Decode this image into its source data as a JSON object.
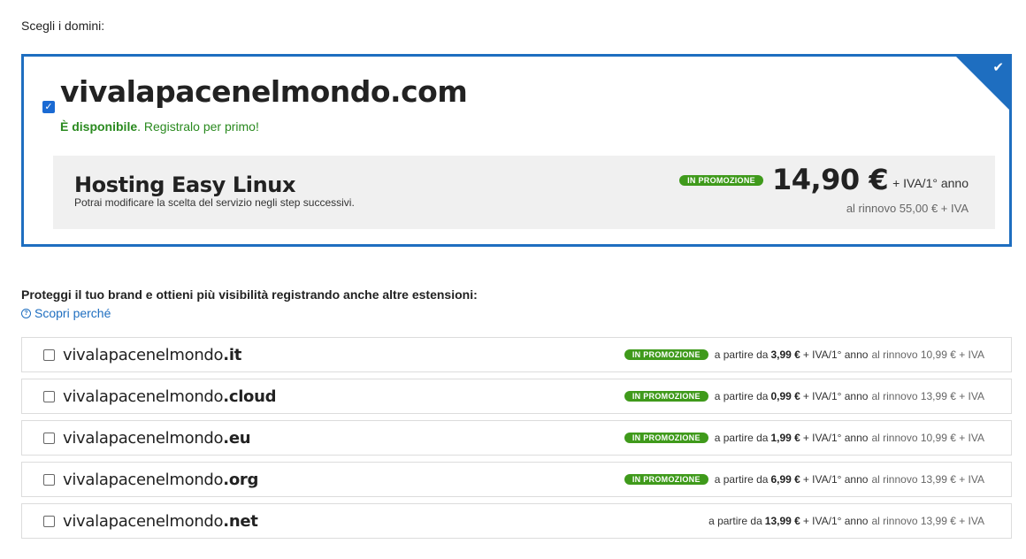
{
  "heading": "Scegli i domini:",
  "main": {
    "domain": "vivalapacenelmondo.com",
    "available_strong": "È disponibile",
    "available_rest": ". Registralo per primo!",
    "hosting_title": "Hosting Easy Linux",
    "hosting_sub": "Potrai modificare la scelta del servizio negli step successivi.",
    "promo": "IN PROMOZIONE",
    "price": "14,90 €",
    "price_suffix": "+ IVA/1° anno",
    "renewal": "al rinnovo 55,00 € + IVA",
    "checked": true
  },
  "section": {
    "title": "Proteggi il tuo brand e ottieni più visibilità registrando anche altre estensioni:",
    "discover": "Scopri perché"
  },
  "extensions": [
    {
      "base": "vivalapacenelmondo",
      "tld": ".it",
      "promo": "IN PROMOZIONE",
      "from": "a partire da",
      "price": "3,99 €",
      "suffix": "+ IVA/1° anno",
      "renew": "al rinnovo 10,99 € + IVA"
    },
    {
      "base": "vivalapacenelmondo",
      "tld": ".cloud",
      "promo": "IN PROMOZIONE",
      "from": "a partire da",
      "price": "0,99 €",
      "suffix": "+ IVA/1° anno",
      "renew": "al rinnovo 13,99 € + IVA"
    },
    {
      "base": "vivalapacenelmondo",
      "tld": ".eu",
      "promo": "IN PROMOZIONE",
      "from": "a partire da",
      "price": "1,99 €",
      "suffix": "+ IVA/1° anno",
      "renew": "al rinnovo 10,99 € + IVA"
    },
    {
      "base": "vivalapacenelmondo",
      "tld": ".org",
      "promo": "IN PROMOZIONE",
      "from": "a partire da",
      "price": "6,99 €",
      "suffix": "+ IVA/1° anno",
      "renew": "al rinnovo 13,99 € + IVA"
    },
    {
      "base": "vivalapacenelmondo",
      "tld": ".net",
      "promo": "",
      "from": "a partire da",
      "price": "13,99 €",
      "suffix": "+ IVA/1° anno",
      "renew": "al rinnovo 13,99 € + IVA"
    }
  ],
  "colors": {
    "accent": "#1e6ec0",
    "promo": "#3f9a1b",
    "available": "#2a8a1f"
  },
  "icons": {
    "selected_corner": "checkmark-icon",
    "help": "help-circle-icon"
  }
}
